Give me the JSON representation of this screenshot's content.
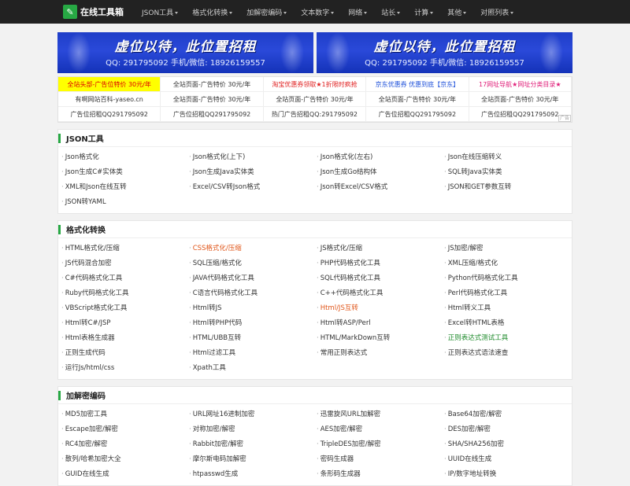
{
  "nav": {
    "logo": "在线工具箱",
    "items": [
      {
        "label": "JSON工具",
        "caret": true
      },
      {
        "label": "格式化转换",
        "caret": true
      },
      {
        "label": "加解密编码",
        "caret": true
      },
      {
        "label": "文本数字",
        "caret": true
      },
      {
        "label": "网络",
        "caret": true
      },
      {
        "label": "站长",
        "caret": true
      },
      {
        "label": "计算",
        "caret": true
      },
      {
        "label": "其他",
        "caret": true
      },
      {
        "label": "对照列表",
        "caret": true
      }
    ]
  },
  "banners": [
    {
      "title": "虚位以待，此位置招租",
      "sub": "QQ: 291795092  手机/微信: 18926159557"
    },
    {
      "title": "虚位以待，此位置招租",
      "sub": "QQ: 291795092  手机/微信: 18926159557"
    }
  ],
  "ads": {
    "rows": [
      [
        "全站头部-广告位特价 30元/年",
        "全站页面-广告特价 30元/年",
        "淘宝优惠券领取★1折限时疯抢",
        "京东优惠券 优惠到底【京东】",
        "17网址导航★网址分类目录★"
      ],
      [
        "有啊网站百科-yaseo.cn",
        "全站页面-广告特价 30元/年",
        "全站页面-广告特价 30元/年",
        "全站页面-广告特价 30元/年",
        "全站页面-广告特价 30元/年"
      ],
      [
        "广告位招租QQ291795092",
        "广告位招租QQ291795092",
        "热门广告招租QQ:291795092",
        "广告位招租QQ291795092",
        "广告位招租QQ291795092"
      ]
    ],
    "mark": "广告"
  },
  "sections": [
    {
      "title": "JSON工具",
      "links": [
        "Json格式化",
        "Json格式化(上下)",
        "Json格式化(左右)",
        "Json在线压缩转义",
        "Json生成C#实体类",
        "Json生成Java实体类",
        "Json生成Go结构体",
        "SQL转Java实体类",
        "XML和Json在线互转",
        "Excel/CSV转Json格式",
        "Json转Excel/CSV格式",
        "JSON和GET参数互转",
        "JSON转YAML"
      ]
    },
    {
      "title": "格式化转换",
      "links": [
        "HTML格式化/压缩",
        "CSS格式化/压缩",
        "JS格式化/压缩",
        "JS加密/解密",
        "JS代码混合加密",
        "SQL压缩/格式化",
        "PHP代码格式化工具",
        "XML压缩/格式化",
        "C#代码格式化工具",
        "JAVA代码格式化工具",
        "SQL代码格式化工具",
        "Python代码格式化工具",
        "Ruby代码格式化工具",
        "C语言代码格式化工具",
        "C++代码格式化工具",
        "Perl代码格式化工具",
        "VBScript格式化工具",
        "Html转JS",
        "Html/JS互转",
        "Html转义工具",
        "Html转C#/JSP",
        "Html转PHP代码",
        "Html转ASP/Perl",
        "Excel转HTML表格",
        "Html表格生成器",
        "HTML/UBB互转",
        "HTML/MarkDown互转",
        "正则表达式测试工具",
        "正则生成代码",
        "Html过滤工具",
        "常用正则表达式",
        "正则表达式语法速查",
        "运行Js/html/css",
        "Xpath工具"
      ]
    },
    {
      "title": "加解密编码",
      "links": [
        "MD5加密工具",
        "URL网址16进制加密",
        "迅雷旋风URL加解密",
        "Base64加密/解密",
        "Escape加密/解密",
        "对称加密/解密",
        "AES加密/解密",
        "DES加密/解密",
        "RC4加密/解密",
        "Rabbit加密/解密",
        "TripleDES加密/解密",
        "SHA/SHA256加密",
        "散列/哈希加密大全",
        "摩尔斯电码加解密",
        "密码生成器",
        "UUID在线生成",
        "GUID在线生成",
        "htpasswd生成",
        "条形码生成器",
        "IP/数字地址转换"
      ]
    }
  ],
  "colors": {
    "accent": "#27a844",
    "nav_bg": "#222222",
    "orange": "#e0561a",
    "green": "#1d8a2a"
  }
}
